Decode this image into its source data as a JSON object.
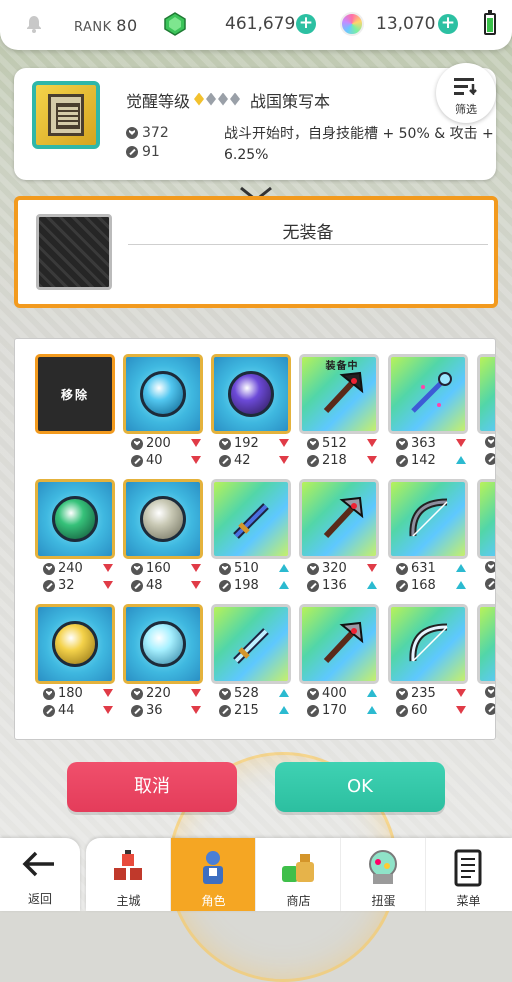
{
  "topbar": {
    "rank_label": "RANK",
    "rank_value": "80",
    "gems": "461,679",
    "orbs": "13,070"
  },
  "selected_item": {
    "name": "觉醒等级",
    "name_suffix": "战国策写本",
    "awaken_level": 1,
    "awaken_max": 4,
    "hp": "372",
    "atk": "91",
    "description": "战斗开始时，自身技能槽 + 50% & 攻击 + 6.25%",
    "filter_label": "筛选"
  },
  "equipment_slot": {
    "status": "无装备"
  },
  "inventory": {
    "remove_label": "移除",
    "equipped_label": "装备中",
    "items": [
      {
        "kind": "remove"
      },
      {
        "kind": "orb",
        "glyph": "blue-orb-icon",
        "hp": "200",
        "hp_dir": "down",
        "atk": "40",
        "atk_dir": "down"
      },
      {
        "kind": "orb",
        "glyph": "purple-orb-icon",
        "hp": "192",
        "hp_dir": "down",
        "atk": "42",
        "atk_dir": "down"
      },
      {
        "kind": "weapon",
        "glyph": "black-axe-icon",
        "equipped": true,
        "hp": "512",
        "hp_dir": "down",
        "atk": "218",
        "atk_dir": "down"
      },
      {
        "kind": "weapon",
        "glyph": "magic-staff-icon",
        "hp": "363",
        "hp_dir": "down",
        "atk": "142",
        "atk_dir": "up"
      },
      {
        "kind": "partial",
        "hp": "",
        "atk": ""
      },
      {
        "kind": "orb",
        "glyph": "green-orb-icon",
        "hp": "240",
        "hp_dir": "down",
        "atk": "32",
        "atk_dir": "down"
      },
      {
        "kind": "orb",
        "glyph": "stone-orb-icon",
        "hp": "160",
        "hp_dir": "down",
        "atk": "48",
        "atk_dir": "down"
      },
      {
        "kind": "weapon",
        "glyph": "blue-sword-icon",
        "hp": "510",
        "hp_dir": "up",
        "atk": "198",
        "atk_dir": "up"
      },
      {
        "kind": "weapon",
        "glyph": "pickaxe-icon",
        "hp": "320",
        "hp_dir": "down",
        "atk": "136",
        "atk_dir": "up"
      },
      {
        "kind": "weapon",
        "glyph": "dark-bow-icon",
        "hp": "631",
        "hp_dir": "up",
        "atk": "168",
        "atk_dir": "up"
      },
      {
        "kind": "partial",
        "hp": "",
        "atk": ""
      },
      {
        "kind": "orb",
        "glyph": "gold-orb-icon",
        "hp": "180",
        "hp_dir": "down",
        "atk": "44",
        "atk_dir": "down"
      },
      {
        "kind": "orb",
        "glyph": "ice-orb-icon",
        "hp": "220",
        "hp_dir": "down",
        "atk": "36",
        "atk_dir": "down"
      },
      {
        "kind": "weapon",
        "glyph": "ice-sword-icon",
        "hp": "528",
        "hp_dir": "up",
        "atk": "215",
        "atk_dir": "up"
      },
      {
        "kind": "weapon",
        "glyph": "battle-axe-icon",
        "hp": "400",
        "hp_dir": "up",
        "atk": "170",
        "atk_dir": "up"
      },
      {
        "kind": "weapon",
        "glyph": "light-bow-icon",
        "hp": "235",
        "hp_dir": "down",
        "atk": "60",
        "atk_dir": "down"
      },
      {
        "kind": "partial",
        "hp": "",
        "atk": ""
      }
    ]
  },
  "actions": {
    "cancel": "取消",
    "ok": "OK"
  },
  "nav": {
    "back": "返回",
    "tabs": [
      "主城",
      "角色",
      "商店",
      "扭蛋",
      "菜单"
    ]
  },
  "colors": {
    "accent_orange": "#f29a1e",
    "teal": "#2cbfa0",
    "red": "#e43c5a",
    "stat_up": "#2bbad0",
    "stat_down": "#e03b47"
  }
}
